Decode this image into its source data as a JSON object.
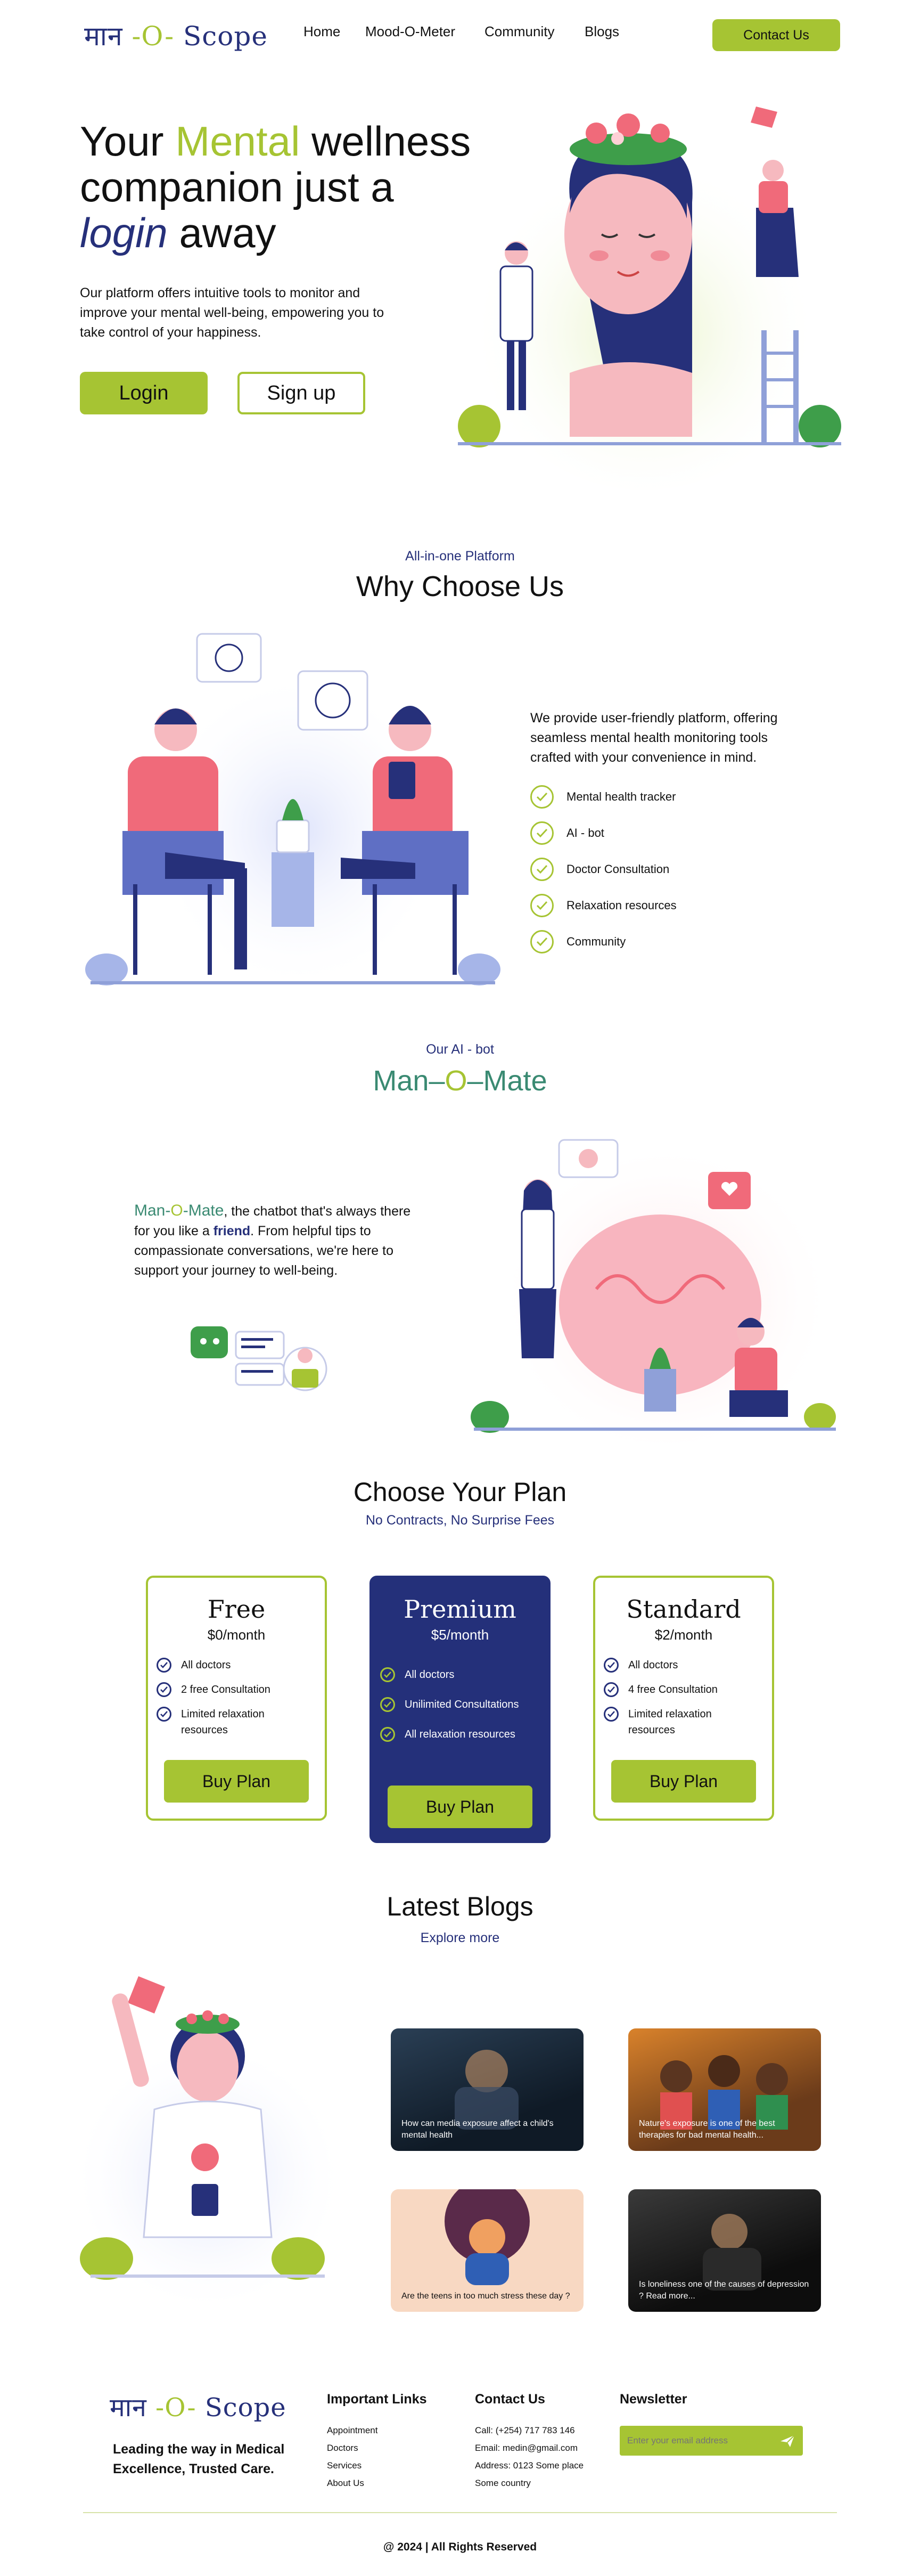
{
  "brand": {
    "logo_part1": "मान",
    "logo_part2": " -O- ",
    "logo_part3": "Scope"
  },
  "nav": {
    "links": [
      "Home",
      "Mood-O-Meter",
      "Community",
      "Blogs"
    ],
    "contact_label": "Contact Us"
  },
  "hero": {
    "title_line1_a": "Your ",
    "title_line1_b": "Mental",
    "title_line1_c": " wellness",
    "title_line2": "companion just a",
    "title_line3_a": "login",
    "title_line3_b": " away",
    "subtitle": "Our platform offers intuitive tools to monitor and improve your mental well-being, empowering you to take control of your happiness.",
    "login_label": "Login",
    "signup_label": "Sign up"
  },
  "why": {
    "eyebrow": "All-in-one Platform",
    "title": "Why Choose Us",
    "description": "We provide user-friendly platform, offering seamless mental health monitoring tools crafted with your convenience in mind.",
    "features": [
      "Mental health tracker",
      "AI - bot",
      "Doctor Consultation",
      "Relaxation resources",
      "Community"
    ]
  },
  "ai": {
    "eyebrow": "Our AI - bot",
    "title_a": "Man",
    "title_b": "–",
    "title_c": "O",
    "title_d": "–",
    "title_e": "Mate",
    "name_a": "Man",
    "name_b": "-",
    "name_c": "O",
    "name_d": "-",
    "name_e": "Mate",
    "text_1": ", the chatbot that's always there for you like a ",
    "friend": "friend",
    "text_2": ". From helpful tips to compassionate conversations, we're here to support your journey to well-being."
  },
  "plans": {
    "title": "Choose Your Plan",
    "subtitle": "No Contracts, No Surprise Fees",
    "items": [
      {
        "name": "Free",
        "price": "$0/month",
        "features": [
          "All doctors",
          "2 free Consultation",
          "Limited relaxation resources"
        ],
        "button": "Buy Plan"
      },
      {
        "name": "Premium",
        "price": "$5/month",
        "features": [
          "All doctors",
          "Unilimited Consultations",
          "All relaxation resources"
        ],
        "button": "Buy Plan"
      },
      {
        "name": "Standard",
        "price": "$2/month",
        "features": [
          "All doctors",
          "4 free Consultation",
          "Limited relaxation resources"
        ],
        "button": "Buy Plan"
      }
    ]
  },
  "blogs": {
    "title": "Latest Blogs",
    "explore": "Explore more",
    "items": [
      "How can media exposure affect a child's mental health",
      "Nature's exposure is one of the best therapies for bad mental health...",
      "Are the teens in too much stress these day ?",
      "Is loneliness one of the causes of depression ? Read more..."
    ]
  },
  "footer": {
    "tagline": "Leading the way in Medical Excellence, Trusted Care.",
    "links_head": "Important Links",
    "links": [
      "Appointment",
      "Doctors",
      "Services",
      "About Us"
    ],
    "contact_head": "Contact Us",
    "contact": [
      "Call: (+254) 717 783 146",
      "Email: medin@gmail.com",
      "Address: 0123 Some place",
      "Some country"
    ],
    "newsletter_head": "Newsletter",
    "newsletter_placeholder": "Enter your email address",
    "copyright": "@ 2024 | All Rights Reserved"
  },
  "colors": {
    "accent": "#a6c433",
    "navy": "#26307a",
    "teal": "#3a8a72",
    "coral": "#f26b6b"
  },
  "icons": [
    "check-icon",
    "send-icon"
  ]
}
